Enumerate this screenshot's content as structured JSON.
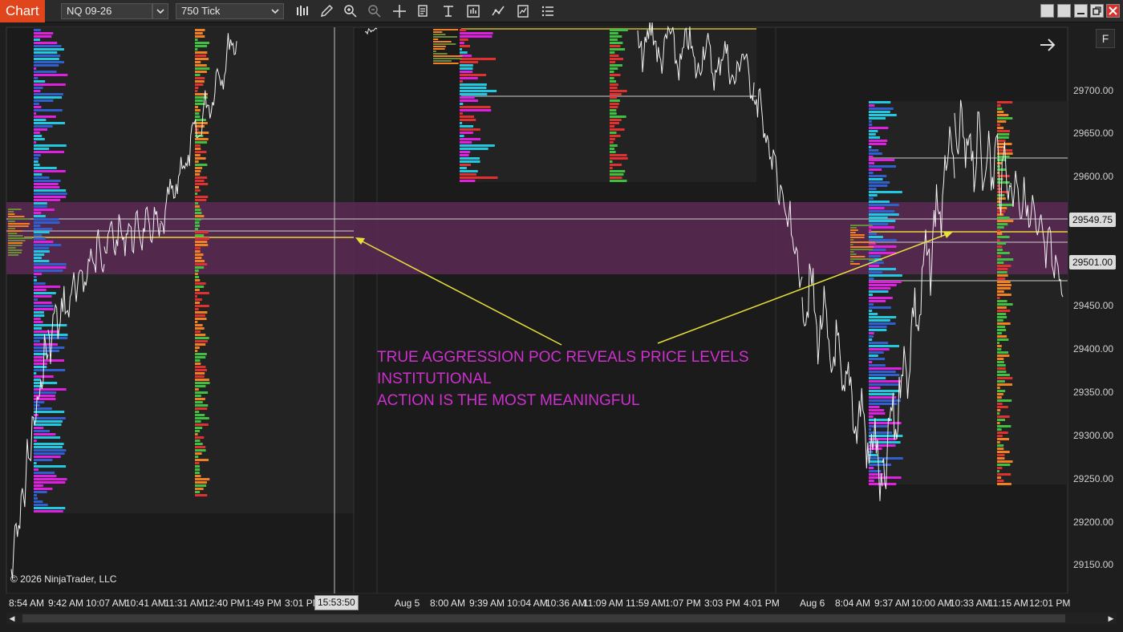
{
  "toolbar": {
    "tab_label": "Chart",
    "instrument": "NQ 09-26",
    "interval": "750 Tick",
    "tools": [
      "bar-type-icon",
      "draw-pencil-icon",
      "zoom-in-icon",
      "zoom-out-icon",
      "crosshair-icon",
      "data-box-icon",
      "chart-properties-icon",
      "templates-icon",
      "strategies-icon",
      "indicators-icon",
      "object-list-icon"
    ]
  },
  "price_axis": {
    "ticks": [
      "29700.00",
      "29650.00",
      "29600.00",
      "29550.00",
      "29450.00",
      "29400.00",
      "29350.00",
      "29300.00",
      "29250.00",
      "29200.00",
      "29150.00"
    ],
    "current_price": "29549.75",
    "marker_price": "29501.00"
  },
  "time_axis": {
    "labels": [
      "8:54 AM",
      "9:42 AM",
      "10:07 AM",
      "10:41 AM",
      "11:31 AM",
      "12:40 PM",
      "1:49 PM",
      "3:01 PM",
      "Aug 5",
      "8:00 AM",
      "9:39 AM",
      "10:04 AM",
      "10:36 AM",
      "11:09 AM",
      "11:59 AM",
      "1:07 PM",
      "3:03 PM",
      "4:01 PM",
      "Aug 6",
      "8:04 AM",
      "9:37 AM",
      "10:00 AM",
      "10:33 AM",
      "11:15 AM",
      "12:01 PM"
    ],
    "cursor_time": "15:53:50"
  },
  "annotation": {
    "line1": "TRUE AGGRESSION POC REVEALS PRICE LEVELS INSTITUTIONAL",
    "line2": "ACTION IS THE MOST MEANINGFUL"
  },
  "copyright": "© 2026 NinjaTrader, LLC",
  "f_button": "F",
  "colors": {
    "accent_tab": "#e0451b",
    "highlight_zone": "#5a2a55",
    "poc_line": "#e8d53a",
    "annotation_text": "#cf30cf",
    "profile_magenta": "#e020e0",
    "profile_cyan": "#20c8e0",
    "profile_green": "#40c040",
    "profile_red": "#e03030",
    "profile_orange": "#f08020"
  }
}
